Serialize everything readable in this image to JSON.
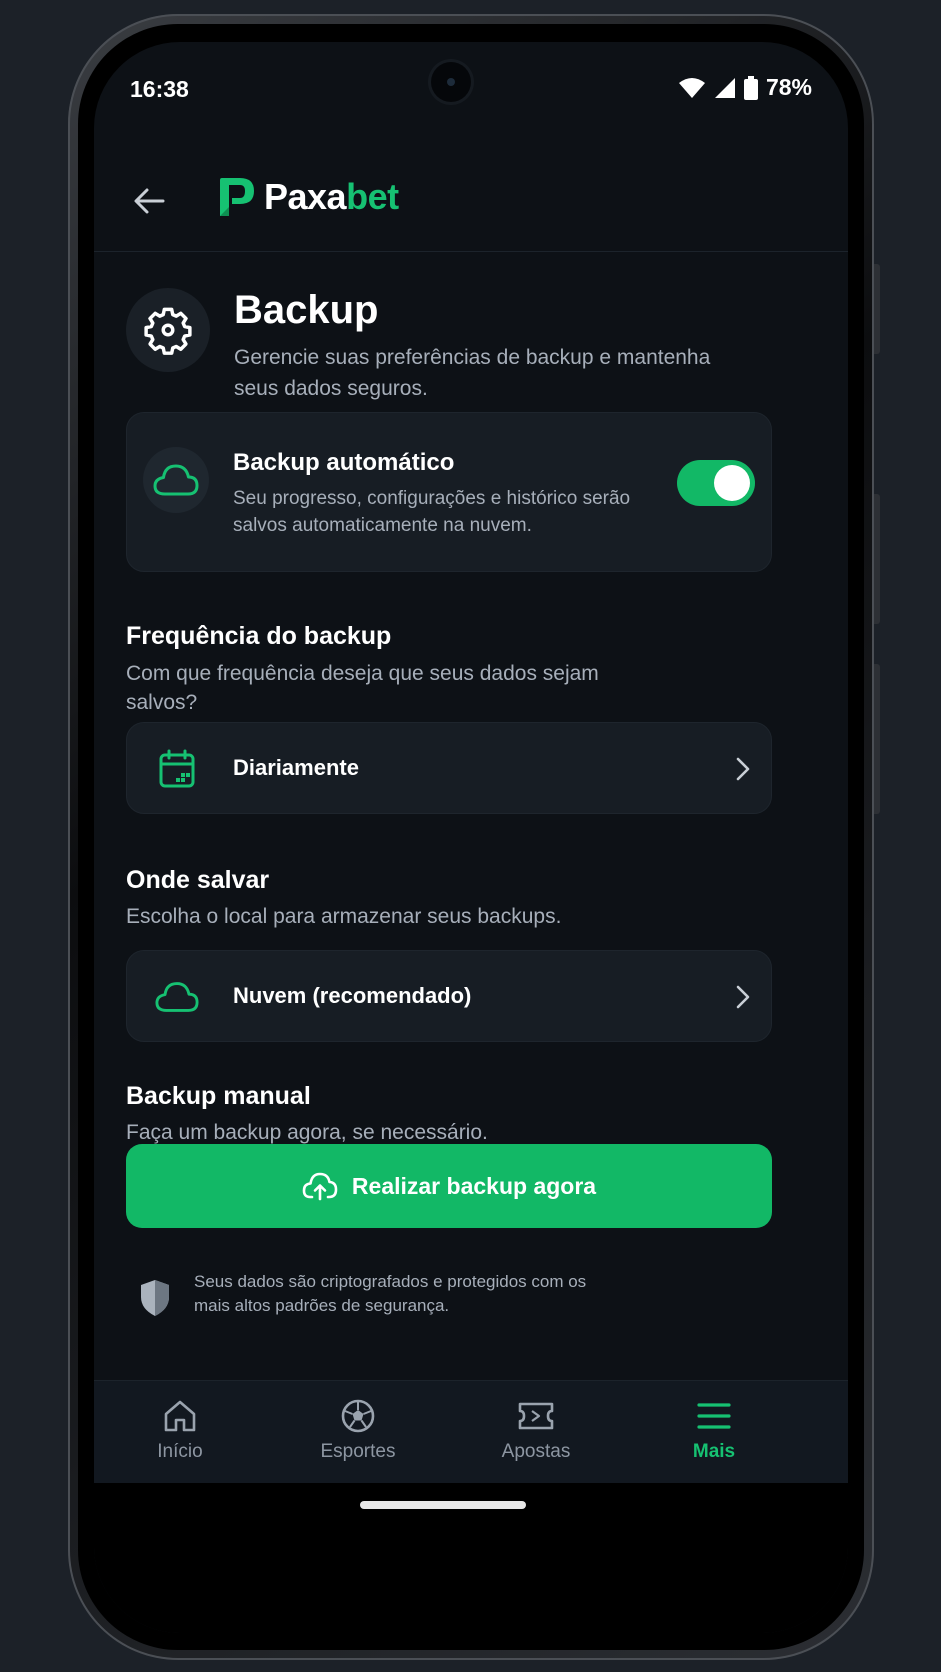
{
  "status_bar": {
    "time": "16:38",
    "battery": "78%"
  },
  "header": {
    "brand_part1": "Paxa",
    "brand_part2": "bet"
  },
  "page": {
    "title": "Backup",
    "subtitle": "Gerencie suas preferências de backup e mantenha seus dados seguros."
  },
  "auto_backup": {
    "title": "Backup automático",
    "description": "Seu progresso, configurações e histórico serão salvos automaticamente na nuvem.",
    "enabled": true
  },
  "frequency": {
    "title": "Frequência do backup",
    "subtitle": "Com que frequência deseja que seus dados sejam salvos?",
    "value": "Diariamente"
  },
  "location": {
    "title": "Onde salvar",
    "subtitle": "Escolha o local para armazenar seus backups.",
    "value": "Nuvem (recomendado)"
  },
  "manual": {
    "title": "Backup manual",
    "subtitle": "Faça um backup agora, se necessário.",
    "button_label": "Realizar backup agora"
  },
  "security_note": "Seus dados são criptografados e protegidos com os mais altos padrões de segurança.",
  "bottom_nav": {
    "items": [
      {
        "label": "Início",
        "icon": "home-icon",
        "active": false
      },
      {
        "label": "Esportes",
        "icon": "soccer-ball-icon",
        "active": false
      },
      {
        "label": "Apostas",
        "icon": "ticket-icon",
        "active": false
      },
      {
        "label": "Mais",
        "icon": "menu-icon",
        "active": true
      }
    ]
  },
  "colors": {
    "accent": "#12b866",
    "background": "#0d1116",
    "card": "#171d24",
    "muted_text": "#a7afba"
  }
}
